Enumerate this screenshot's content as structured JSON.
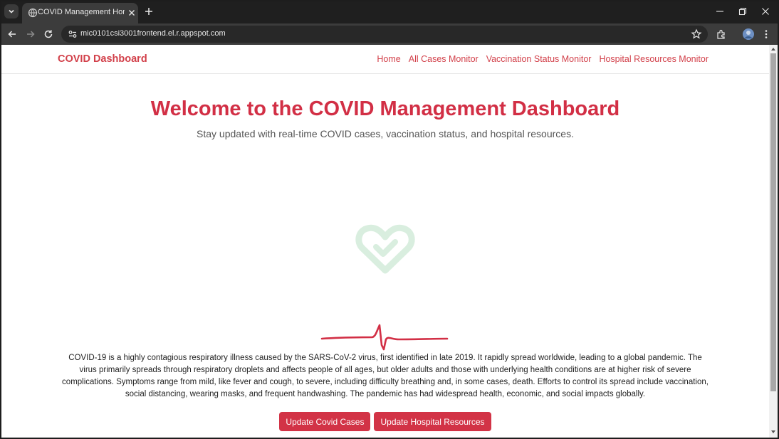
{
  "browser": {
    "tab_title": "COVID Management Home",
    "url": "mic0101csi3001frontend.el.r.appspot.com"
  },
  "navbar": {
    "brand": "COVID Dashboard",
    "links": [
      "Home",
      "All Cases Monitor",
      "Vaccination Status Monitor",
      "Hospital Resources Monitor"
    ]
  },
  "hero": {
    "title": "Welcome to the COVID Management Dashboard",
    "subtitle": "Stay updated with real-time COVID cases, vaccination status, and hospital resources."
  },
  "intro_text": "COVID-19 is a highly contagious respiratory illness caused by the SARS-CoV-2 virus, first identified in late 2019. It rapidly spread worldwide, leading to a global pandemic. The virus primarily spreads through respiratory droplets and affects people of all ages, but older adults and those with underlying health conditions are at higher risk of severe complications. Symptoms range from mild, like fever and cough, to severe, including difficulty breathing and, in some cases, death. Efforts to control its spread include vaccination, social distancing, wearing masks, and frequent handwashing. The pandemic has had widespread health, economic, and social impacts globally.",
  "buttons": {
    "update_cases": "Update Covid Cases",
    "update_hospital": "Update Hospital Resources"
  },
  "colors": {
    "brand": "#d2404a",
    "title": "#d22f45",
    "button": "#d23346",
    "heart_icon": "#d9eedf",
    "pulse_line": "#d22f45"
  },
  "icons": {
    "heart": "heart-check-icon",
    "pulse": "heartbeat-line-icon"
  }
}
